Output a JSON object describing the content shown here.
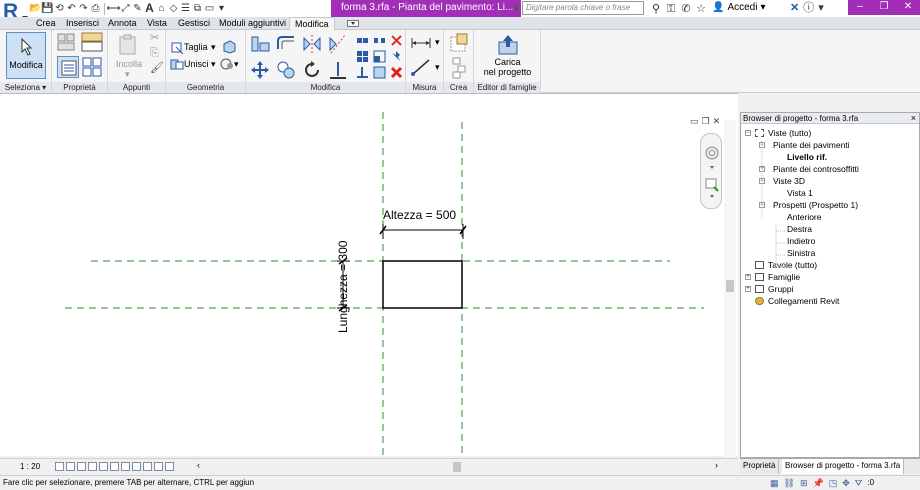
{
  "app": {
    "logo_letter": "R",
    "title": "forma 3.rfa - Pianta del pavimento: Li...",
    "search_placeholder": "Digitare parola chiave o frase",
    "user_label": "Accedi"
  },
  "tabs": [
    {
      "label": "Crea"
    },
    {
      "label": "Inserisci"
    },
    {
      "label": "Annota"
    },
    {
      "label": "Vista"
    },
    {
      "label": "Gestisci"
    },
    {
      "label": "Moduli aggiuntivi"
    },
    {
      "label": "Modifica"
    }
  ],
  "ribbon": {
    "panels": [
      {
        "label": "Seleziona",
        "has_dropdown": true
      },
      {
        "label": "Proprietà"
      },
      {
        "label": "Appunti"
      },
      {
        "label": "Geometria"
      },
      {
        "label": "Modifica"
      },
      {
        "label": "Misura"
      },
      {
        "label": "Crea"
      },
      {
        "label": "Editor di famiglie"
      }
    ],
    "modify_button": "Modifica",
    "paste_label": "Incolla",
    "cut_label": "Taglia",
    "join_label": "Unisci",
    "load_label_line1": "Carica",
    "load_label_line2": "nel progetto",
    "dropdown_glyph": "▾"
  },
  "canvas": {
    "dim_horizontal": "Altezza = 500",
    "dim_vertical": "Lunghezza = 300"
  },
  "viewbar": {
    "scale": "1 : 20"
  },
  "browser": {
    "title": "Browser di progetto - forma 3.rfa",
    "close_glyph": "×",
    "tree": [
      {
        "label": "Viste (tutto)",
        "expander": "−",
        "bold": false
      },
      {
        "label": "Piante dei pavimenti",
        "expander": "−",
        "bold": false
      },
      {
        "label": "Livello rif.",
        "expander": "",
        "bold": true
      },
      {
        "label": "Piante dei controsoffitti",
        "expander": "+",
        "bold": false
      },
      {
        "label": "Viste 3D",
        "expander": "−",
        "bold": false
      },
      {
        "label": "Vista 1",
        "expander": "",
        "bold": false
      },
      {
        "label": "Prospetti (Prospetto 1)",
        "expander": "−",
        "bold": false
      },
      {
        "label": "Anteriore",
        "expander": "",
        "bold": false
      },
      {
        "label": "Destra",
        "expander": "",
        "bold": false
      },
      {
        "label": "Indietro",
        "expander": "",
        "bold": false
      },
      {
        "label": "Sinistra",
        "expander": "",
        "bold": false
      },
      {
        "label": "Tavole (tutto)",
        "expander": "",
        "bold": false
      },
      {
        "label": "Famiglie",
        "expander": "+",
        "bold": false
      },
      {
        "label": "Gruppi",
        "expander": "+",
        "bold": false
      },
      {
        "label": "Collegamenti Revit",
        "expander": "",
        "bold": false
      }
    ],
    "tabs": [
      {
        "label": "Proprietà"
      },
      {
        "label": "Browser di progetto - forma 3.rfa"
      }
    ]
  },
  "status": {
    "text": "Fare clic per selezionare, premere TAB per alternare, CTRL per aggiun",
    "filter_count": ":0"
  },
  "colors": {
    "title_accent": "#a22eb8",
    "reference_plane": "#2e8b2e",
    "logo": "#2b5ba6"
  }
}
